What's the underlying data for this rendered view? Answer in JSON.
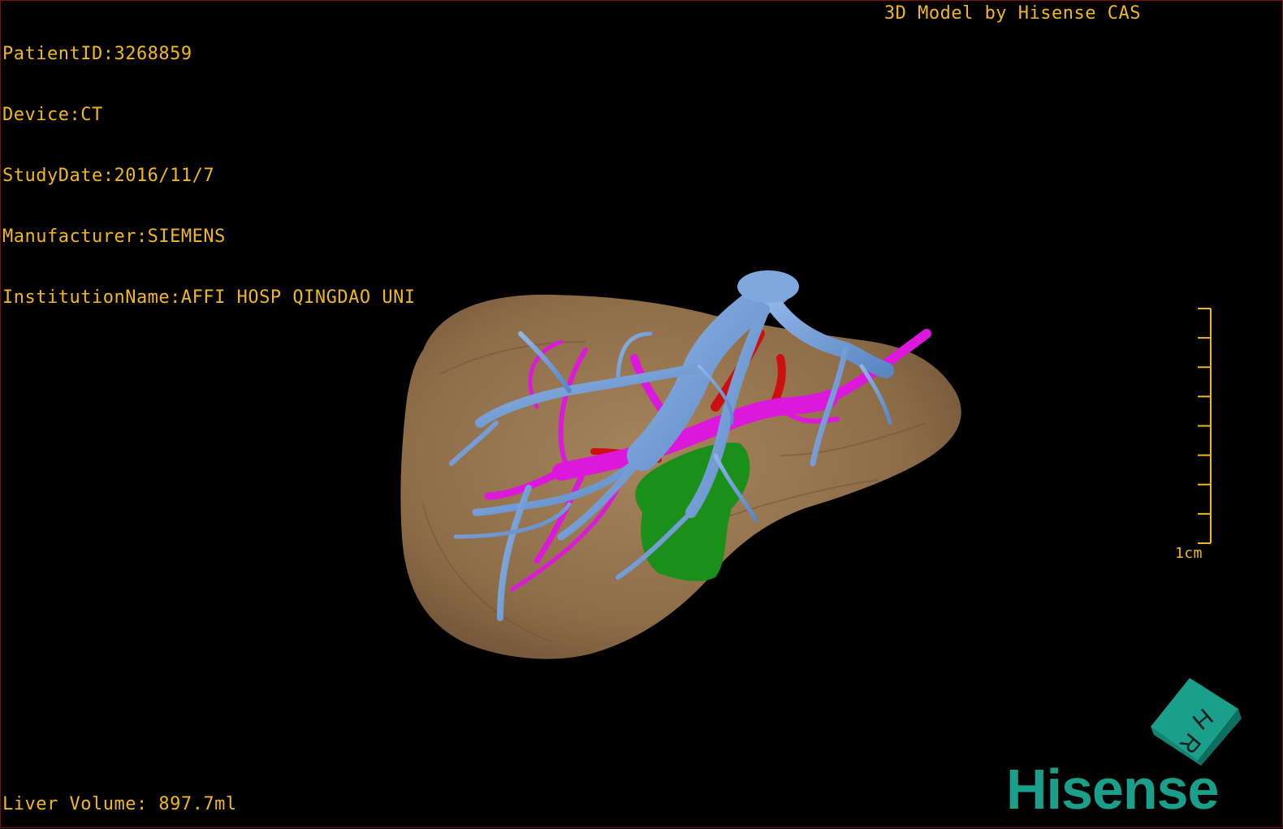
{
  "viewer": {
    "credit": "3D Model by Hisense CAS",
    "logo": "Hisense"
  },
  "patient_info": {
    "patient_id": "PatientID:3268859",
    "device": "Device:CT",
    "study_date": "StudyDate:2016/11/7",
    "manufacturer": "Manufacturer:SIEMENS",
    "institution": "InstitutionName:AFFI HOSP QINGDAO UNI"
  },
  "measurements": {
    "liver_volume": "Liver Volume: 897.7ml"
  },
  "scale_bar": {
    "label": "1cm",
    "tick_count": 9,
    "color": "#f0b81a"
  },
  "orientation_cube": {
    "face_labels": [
      "H",
      "R"
    ],
    "color": "#1aa08a"
  },
  "structures": [
    {
      "name": "liver",
      "color": "#94724f"
    },
    {
      "name": "hepatic-vein",
      "color": "#6e9bd6"
    },
    {
      "name": "portal-vein",
      "color": "#dd18dd"
    },
    {
      "name": "hepatic-artery",
      "color": "#cc1010"
    },
    {
      "name": "tumor",
      "color": "#1a8f1a"
    }
  ]
}
